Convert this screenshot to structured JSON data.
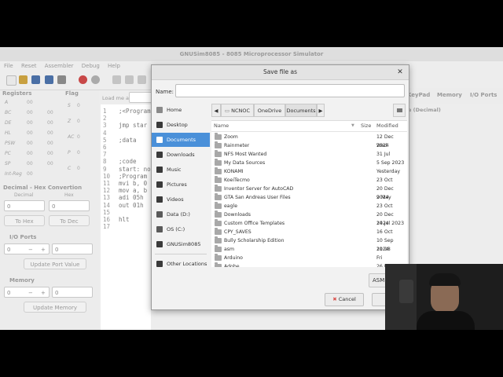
{
  "window": {
    "title": "GNUSim8085 - 8085 Microprocessor Simulator"
  },
  "menu": [
    "File",
    "Reset",
    "Assembler",
    "Debug",
    "Help"
  ],
  "left_panel": {
    "registers_title": "Registers",
    "flag_title": "Flag",
    "registers": [
      {
        "name": "A",
        "value": "00"
      },
      {
        "name": "BC",
        "value": "00",
        "value2": "00"
      },
      {
        "name": "DE",
        "value": "00",
        "value2": "00"
      },
      {
        "name": "HL",
        "value": "00",
        "value2": "00"
      },
      {
        "name": "PSW",
        "value": "00",
        "value2": "00"
      },
      {
        "name": "PC",
        "value": "00",
        "value2": "00"
      },
      {
        "name": "SP",
        "value": "00",
        "value2": "00"
      },
      {
        "name": "Int-Reg",
        "value": "00"
      }
    ],
    "flags": [
      {
        "name": "S",
        "value": "0"
      },
      {
        "name": "Z",
        "value": "0"
      },
      {
        "name": "AC",
        "value": "0"
      },
      {
        "name": "P",
        "value": "0"
      },
      {
        "name": "C",
        "value": "0"
      }
    ],
    "conversion_title": "Decimal - Hex Convertion",
    "decimal_label": "Decimal",
    "hex_label": "Hex",
    "decimal_value": "0",
    "hex_value": "0",
    "to_hex": "To Hex",
    "to_dec": "To Dec",
    "io_title": "I/O Ports",
    "io_port": "0",
    "io_value": "0",
    "update_port": "Update Port Value",
    "memory_title": "Memory",
    "mem_addr": "0",
    "mem_value": "0",
    "update_memory": "Update Memory",
    "minus": "−",
    "plus": "+"
  },
  "editor": {
    "load_label": "Load me at",
    "line_numbers": [
      "1",
      "2",
      "3",
      "4",
      "5",
      "6",
      "7",
      "8",
      "9",
      "10",
      "11",
      "12",
      "13",
      "14",
      "15",
      "16",
      "17"
    ],
    "code_lines": [
      ";<Program",
      "",
      "jmp star",
      "",
      ";data",
      "",
      "",
      ";code",
      "start: no",
      ";Program",
      "mvi b, 0",
      "mov a, b",
      "adi 05h",
      "out 01h",
      "",
      "hlt",
      ""
    ]
  },
  "right_tabs": [
    "KeyPad",
    "Memory",
    "I/O Ports"
  ],
  "right_subtitle": "e (Decimal)",
  "dialog": {
    "title": "Save file as",
    "name_label": "Name:",
    "name_value": "",
    "places": [
      {
        "label": "Home",
        "icon": "home-icon",
        "color": "#8a8a8a",
        "selected": false
      },
      {
        "label": "Desktop",
        "icon": "desktop-icon",
        "color": "#3a3a3a",
        "selected": false
      },
      {
        "label": "Documents",
        "icon": "documents-icon",
        "color": "#ffffff",
        "selected": true
      },
      {
        "label": "Downloads",
        "icon": "downloads-icon",
        "color": "#3a3a3a",
        "selected": false
      },
      {
        "label": "Music",
        "icon": "music-icon",
        "color": "#3a3a3a",
        "selected": false
      },
      {
        "label": "Pictures",
        "icon": "pictures-icon",
        "color": "#3a3a3a",
        "selected": false
      },
      {
        "label": "Videos",
        "icon": "videos-icon",
        "color": "#3a3a3a",
        "selected": false
      },
      {
        "label": "Data (D:)",
        "icon": "drive-icon",
        "color": "#5a5a5a",
        "selected": false
      },
      {
        "label": "OS (C:)",
        "icon": "drive-icon",
        "color": "#5a5a5a",
        "selected": false
      },
      {
        "label": "GNUSim8085",
        "icon": "folder-icon",
        "color": "#3a3a3a",
        "selected": false
      },
      {
        "label": "Other Locations",
        "icon": "other-locations-icon",
        "color": "#3a3a3a",
        "selected": false
      }
    ],
    "path": [
      "NCNOC",
      "OneDrive",
      "Documents"
    ],
    "columns": {
      "name": "Name",
      "size": "Size",
      "modified": "Modified"
    },
    "files": [
      {
        "name": "Zoom",
        "modified": "12 Dec 2024"
      },
      {
        "name": "Rainmeter",
        "modified": "Wed"
      },
      {
        "name": "NFS Most Wanted",
        "modified": "31 Jul"
      },
      {
        "name": "My Data Sources",
        "modified": "5 Sep 2023"
      },
      {
        "name": "KONAMI",
        "modified": "Yesterday"
      },
      {
        "name": "KoeiTecmo",
        "modified": "23 Oct"
      },
      {
        "name": "Inventor Server for AutoCAD",
        "modified": "20 Dec 2024"
      },
      {
        "name": "GTA San Andreas User Files",
        "modified": "9 May"
      },
      {
        "name": "eagle",
        "modified": "23 Oct"
      },
      {
        "name": "Downloads",
        "modified": "20 Dec 2024"
      },
      {
        "name": "Custom Office Templates",
        "modified": "14 Jul 2023"
      },
      {
        "name": "CPY_SAVES",
        "modified": "16 Oct"
      },
      {
        "name": "Bully Scholarship Edition",
        "modified": "10 Sep 2024"
      },
      {
        "name": "asm",
        "modified": "11:18"
      },
      {
        "name": "Arduino",
        "modified": "Fri"
      },
      {
        "name": "Adobe",
        "modified": "26 Jul"
      }
    ],
    "filter": "ASM",
    "cancel": "Cancel"
  },
  "colors": {
    "accent": "#4a90d9",
    "cancel_icon": "#d9534f",
    "folder": "#a8a8a8"
  }
}
